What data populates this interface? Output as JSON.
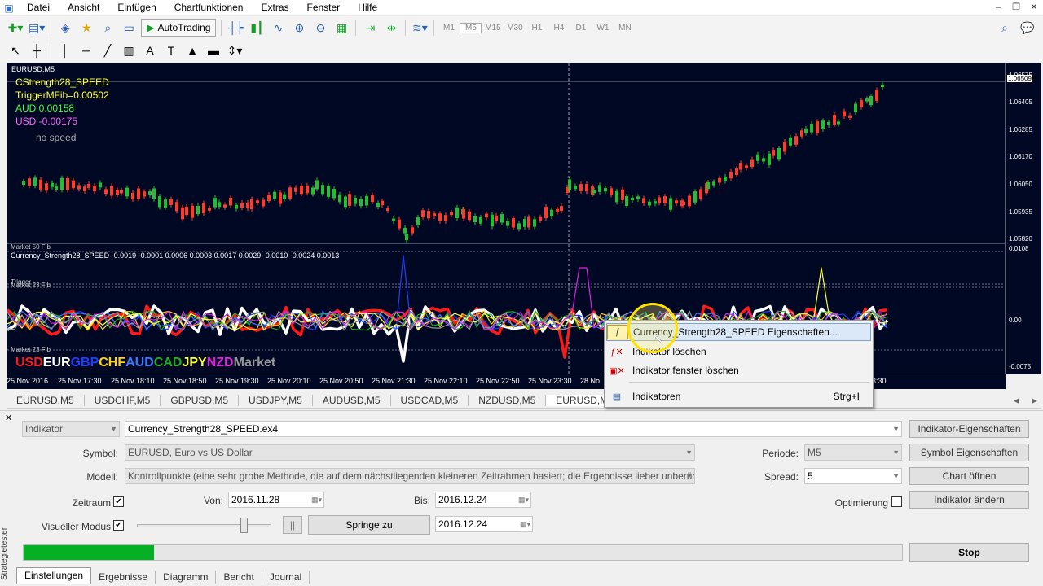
{
  "menu": [
    "Datei",
    "Ansicht",
    "Einfügen",
    "Chartfunktionen",
    "Extras",
    "Fenster",
    "Hilfe"
  ],
  "toolbar": {
    "autotrading_label": "AutoTrading",
    "timeframes": [
      "M1",
      "M5",
      "M15",
      "M30",
      "H1",
      "H4",
      "D1",
      "W1",
      "MN"
    ]
  },
  "chart": {
    "symbol_label": "EURUSD,M5",
    "overlay": {
      "indicator": "CStrength28_SPEED",
      "trigger": "TriggerMFib=0.00502",
      "aud": "AUD 0.00158",
      "usd": "USD -0.00175",
      "speed": "no speed"
    },
    "price_levels": [
      "1.06575",
      "1.06509",
      "1.06405",
      "1.06285",
      "1.06170",
      "1.06050",
      "1.05935",
      "1.05820"
    ],
    "sub_title": "Currency_Strength28_SPEED  -0.0019 -0.0001 0.0006 0.0003 0.0017 0.0029 -0.0010 -0.0024 0.0013",
    "sub_scale": [
      "0.0108",
      "0.00",
      "-0.0075"
    ],
    "level_labels": [
      "Market 50 Fib",
      "Trigger",
      "Market 23 Fib",
      "Market 23 Fib"
    ],
    "currencies": [
      {
        "name": "USD",
        "color": "#ff1a1a"
      },
      {
        "name": "EUR",
        "color": "#ffffff"
      },
      {
        "name": "GBP",
        "color": "#1f3fff"
      },
      {
        "name": "CHF",
        "color": "#ffd400"
      },
      {
        "name": "AUD",
        "color": "#3a78ff"
      },
      {
        "name": "CAD",
        "color": "#20b020"
      },
      {
        "name": "JPY",
        "color": "#ffff30"
      },
      {
        "name": "NZD",
        "color": "#e020e0"
      },
      {
        "name": "Market",
        "color": "#9a9a9a"
      }
    ],
    "time_labels": [
      "25 Nov 2016",
      "25 Nov 17:30",
      "25 Nov 18:10",
      "25 Nov 18:50",
      "25 Nov 19:30",
      "25 Nov 20:10",
      "25 Nov 20:50",
      "25 Nov 21:30",
      "25 Nov 22:10",
      "25 Nov 22:50",
      "25 Nov 23:30",
      "28 No",
      "3:30"
    ]
  },
  "chart_tabs": [
    "EURUSD,M5",
    "USDCHF,M5",
    "GBPUSD,M5",
    "USDJPY,M5",
    "AUDUSD,M5",
    "USDCAD,M5",
    "NZDUSD,M5",
    "EURUSD,M5 (visual)"
  ],
  "context_menu": {
    "items": [
      {
        "label": "Currency_Strength28_SPEED  Eigenschaften...",
        "shortcut": ""
      },
      {
        "label": "Indikator löschen",
        "shortcut": ""
      },
      {
        "label": "Indikator fenster löschen",
        "shortcut": ""
      },
      {
        "label": "Indikatoren",
        "shortcut": "Strg+I"
      }
    ]
  },
  "tester": {
    "mode": "Indikator",
    "file": "Currency_Strength28_SPEED.ex4",
    "symbol_label": "Symbol:",
    "symbol_value": "EURUSD, Euro vs US Dollar",
    "model_label": "Modell:",
    "model_value": "Kontrollpunkte (eine sehr grobe Methode, die auf dem nächstliegenden kleineren Zeitrahmen basiert; die Ergebnisse lieber unberücksichtigt lasse",
    "period_label": "Periode:",
    "period_value": "M5",
    "spread_label": "Spread:",
    "spread_value": "5",
    "zeitraum_label": "Zeitraum",
    "von_label": "Von:",
    "von_value": "2016.11.28",
    "bis_label": "Bis:",
    "bis_value": "2016.12.24",
    "visual_label": "Visueller Modus",
    "pause_label": "||",
    "jump_label": "Springe zu",
    "jump_date": "2016.12.24",
    "optim_label": "Optimierung",
    "buttons": {
      "indicator_props": "Indikator-Eigenschaften",
      "symbol_props": "Symbol Eigenschaften",
      "open_chart": "Chart öffnen",
      "modify_indicator": "Indikator ändern",
      "stop": "Stop"
    },
    "progress": 0.148,
    "tabs": [
      "Einstellungen",
      "Ergebnisse",
      "Diagramm",
      "Bericht",
      "Journal"
    ],
    "vertical_label": "Strategietester"
  }
}
